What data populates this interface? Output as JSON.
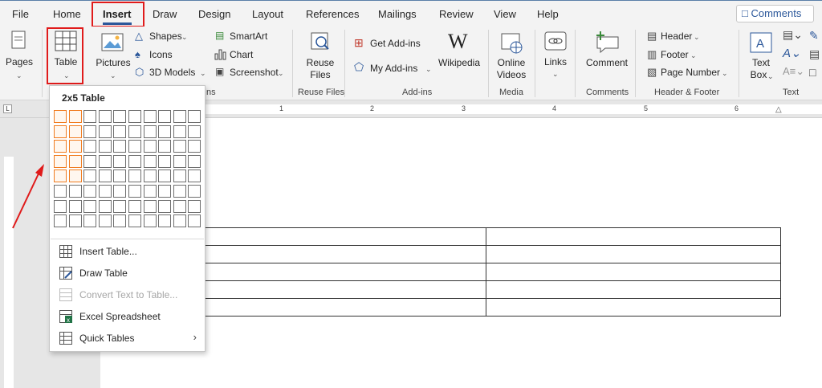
{
  "tabs": [
    "File",
    "Home",
    "Insert",
    "Draw",
    "Design",
    "Layout",
    "References",
    "Mailings",
    "Review",
    "View",
    "Help"
  ],
  "comments_label": "Comments",
  "ribbon": {
    "pages": "Pages",
    "table": "Table",
    "pictures": "Pictures",
    "shapes": "Shapes",
    "icons": "Icons",
    "models": "3D Models",
    "smartart": "SmartArt",
    "chart": "Chart",
    "screenshot": "Screenshot",
    "reuse": "Reuse",
    "files": "Files",
    "get_addins": "Get Add-ins",
    "my_addins": "My Add-ins",
    "wikipedia": "Wikipedia",
    "online": "Online",
    "videos": "Videos",
    "links": "Links",
    "comment": "Comment",
    "header": "Header",
    "footer": "Footer",
    "page_number": "Page Number",
    "text": "Text",
    "box": "Box"
  },
  "groups": {
    "illustrations_tail": "ns",
    "reuse_files": "Reuse Files",
    "addins": "Add-ins",
    "media": "Media",
    "comments": "Comments",
    "header_footer": "Header & Footer",
    "text": "Text"
  },
  "ruler_numbers": [
    "1",
    "2",
    "3",
    "4",
    "5",
    "6"
  ],
  "dropdown": {
    "title": "2x5 Table",
    "selected_cols": 2,
    "selected_rows": 5,
    "grid_cols": 10,
    "grid_rows": 8,
    "items": [
      {
        "label": "Insert Table...",
        "icon": "table-grid-icon",
        "disabled": false
      },
      {
        "label": "Draw Table",
        "icon": "pencil-table-icon",
        "disabled": false
      },
      {
        "label": "Convert Text to Table...",
        "icon": "convert-table-icon",
        "disabled": true
      },
      {
        "label": "Excel Spreadsheet",
        "icon": "excel-icon",
        "disabled": false
      },
      {
        "label": "Quick Tables",
        "icon": "quick-tables-icon",
        "disabled": false
      }
    ]
  },
  "document_table": {
    "cols": 2,
    "rows": 5
  },
  "colors": {
    "accent": "#2b579a",
    "highlight": "#e01b1b",
    "grid_selected": "#f07b1f"
  }
}
